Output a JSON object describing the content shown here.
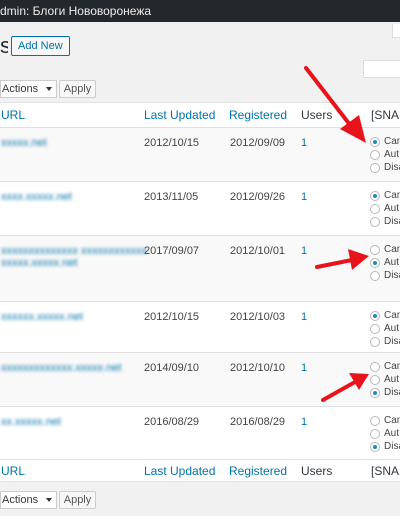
{
  "adminbar": {
    "title": "dmin: Блоги Нововоронежа"
  },
  "page": {
    "title": "s",
    "add_new_label": "Add New"
  },
  "bulk": {
    "selected": "Actions",
    "apply_label": "Apply"
  },
  "table": {
    "columns": {
      "url": "URL",
      "last_updated": "Last Updated",
      "registered": "Registered",
      "users": "Users",
      "snap": "[SNAP"
    },
    "rows": [
      {
        "url": "xxxxx.net",
        "last_updated": "2012/10/15",
        "registered": "2012/09/09",
        "users": "1",
        "options": [
          "Can",
          "Aut",
          "Disa"
        ],
        "checked": 0
      },
      {
        "url": "xxxx.xxxxx.net",
        "last_updated": "2013/11/05",
        "registered": "2012/09/26",
        "users": "1",
        "options": [
          "Can",
          "Aut",
          "Disa"
        ],
        "checked": 0
      },
      {
        "url": "xxxxxxxxxxxxxx xxxxxxxxxxxx",
        "url2": "xxxxx.xxxxx.net",
        "last_updated": "2017/09/07",
        "registered": "2012/10/01",
        "users": "1",
        "options": [
          "Can",
          "Aut",
          "Disa"
        ],
        "checked": 1
      },
      {
        "url": "xxxxxx.xxxxx.net",
        "last_updated": "2012/10/15",
        "registered": "2012/10/03",
        "users": "1",
        "options": [
          "Can",
          "Aut",
          "Disa"
        ],
        "checked": 0
      },
      {
        "url": "xxxxxxxxxxxxx.xxxxx.net",
        "last_updated": "2014/09/10",
        "registered": "2012/10/10",
        "users": "1",
        "options": [
          "Can",
          "Aut",
          "Disa"
        ],
        "checked": 2
      },
      {
        "url": "xx.xxxxx.net",
        "last_updated": "2016/08/29",
        "registered": "2016/08/29",
        "users": "1",
        "options": [
          "Can",
          "Aut",
          "Disa"
        ],
        "checked": 2
      }
    ]
  },
  "colors": {
    "link": "#0073aa",
    "arrow": "#e8141b",
    "radio_checked": "#1e8cbe"
  }
}
